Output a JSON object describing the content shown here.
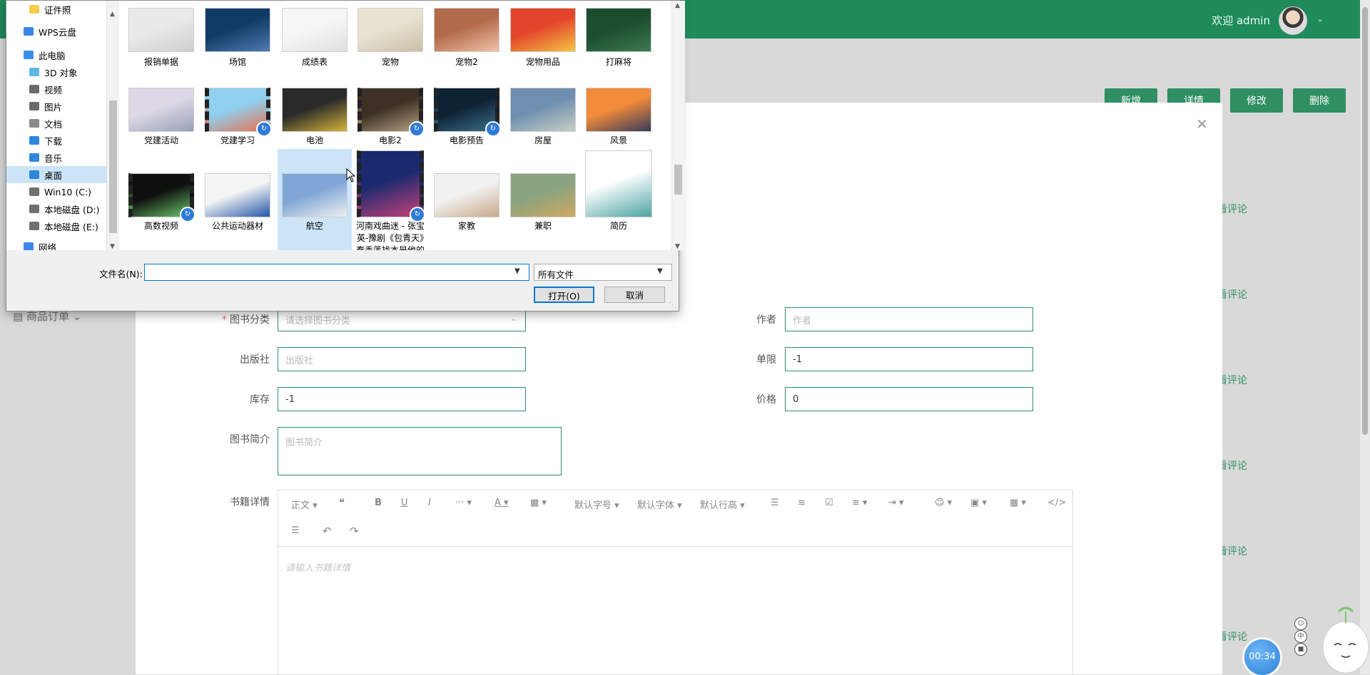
{
  "app": {
    "welcome_text": "欢迎 admin",
    "toolbar": {
      "new": "新增",
      "detail": "详情",
      "edit": "修改",
      "delete": "删除"
    },
    "side_menu_order": "商品订单",
    "comment_link": "看评论",
    "accent_color": "#1f8a5a"
  },
  "form": {
    "category": {
      "label": "图书分类",
      "placeholder": "请选择图书分类",
      "required": true
    },
    "author": {
      "label": "作者",
      "placeholder": "作者"
    },
    "publisher": {
      "label": "出版社",
      "placeholder": "出版社"
    },
    "limit": {
      "label": "单限",
      "value": "-1"
    },
    "stock": {
      "label": "库存",
      "value": "-1"
    },
    "price": {
      "label": "价格",
      "value": "0"
    },
    "summary": {
      "label": "图书简介",
      "placeholder": "图书简介"
    },
    "details": {
      "label": "书籍详情",
      "placeholder": "请输入书籍详情"
    }
  },
  "editor_toolbar": {
    "paragraph": "正文",
    "font_size": "默认字号",
    "font_family": "默认字体",
    "line_height": "默认行高"
  },
  "file_dialog": {
    "nav_items": [
      {
        "label": "证件照",
        "icon": "folder-icon"
      },
      {
        "label": "WPS云盘",
        "icon": "cloud-icon"
      },
      {
        "label": "此电脑",
        "icon": "pc-icon"
      },
      {
        "label": "3D 对象",
        "icon": "cube-icon"
      },
      {
        "label": "视频",
        "icon": "video-icon"
      },
      {
        "label": "图片",
        "icon": "picture-icon"
      },
      {
        "label": "文档",
        "icon": "document-icon"
      },
      {
        "label": "下载",
        "icon": "download-icon"
      },
      {
        "label": "音乐",
        "icon": "music-icon"
      },
      {
        "label": "桌面",
        "icon": "desktop-icon",
        "selected": true
      },
      {
        "label": "Win10 (C:)",
        "icon": "drive-icon"
      },
      {
        "label": "本地磁盘 (D:)",
        "icon": "drive-icon"
      },
      {
        "label": "本地磁盘 (E:)",
        "icon": "drive-icon"
      },
      {
        "label": "网络",
        "icon": "network-icon"
      }
    ],
    "files": [
      {
        "name": "报销单据"
      },
      {
        "name": "场馆"
      },
      {
        "name": "成绩表"
      },
      {
        "name": "宠物"
      },
      {
        "name": "宠物2"
      },
      {
        "name": "宠物用品"
      },
      {
        "name": "打麻将"
      },
      {
        "name": "党建活动"
      },
      {
        "name": "党建学习",
        "video": true
      },
      {
        "name": "电池"
      },
      {
        "name": "电影2",
        "video": true
      },
      {
        "name": "电影预告",
        "video": true
      },
      {
        "name": "房屋"
      },
      {
        "name": "风景"
      },
      {
        "name": "高数视频",
        "video": true
      },
      {
        "name": "公共运动器材"
      },
      {
        "name": "航空",
        "selected": true
      },
      {
        "name": "河南戏曲迷 - 张宝英-豫剧《包青天》秦香莲找本是他的结发妻",
        "video": true
      },
      {
        "name": "家教"
      },
      {
        "name": "兼职"
      },
      {
        "name": "简历"
      }
    ],
    "filename_label": "文件名(N):",
    "filename_value": "",
    "filetype_value": "所有文件",
    "open_button": "打开(O)",
    "cancel_button": "取消"
  },
  "timer": "00:34"
}
